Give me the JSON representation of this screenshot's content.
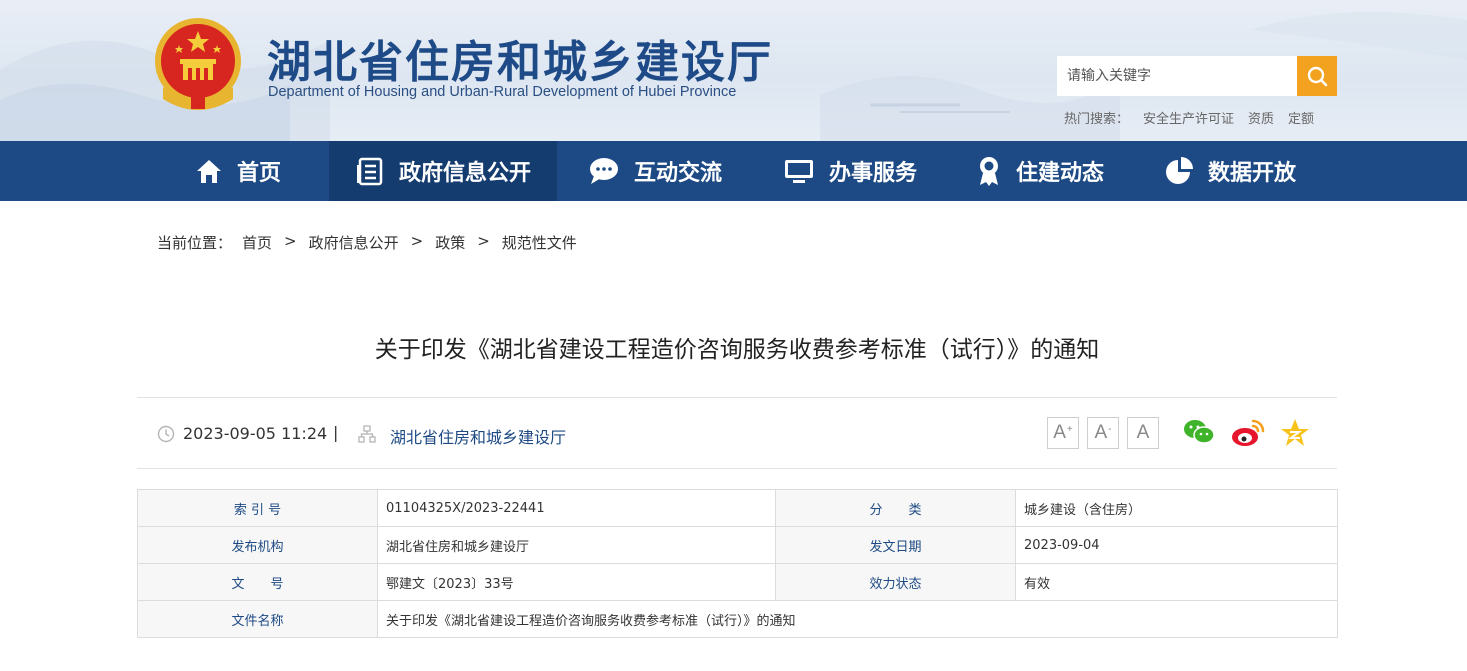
{
  "header": {
    "title": "湖北省住房和城乡建设厅",
    "subtitle": "Department of Housing and Urban-Rural Development of Hubei Province",
    "search": {
      "placeholder": "请输入关键字"
    },
    "hot_search": {
      "label": "热门搜索：",
      "links": [
        "安全生产许可证",
        "资质",
        "定额"
      ]
    }
  },
  "nav": {
    "items": [
      {
        "label": "首页",
        "icon": "home-icon"
      },
      {
        "label": "政府信息公开",
        "icon": "document-list-icon",
        "active": true
      },
      {
        "label": "互动交流",
        "icon": "chat-bubble-icon"
      },
      {
        "label": "办事服务",
        "icon": "monitor-icon"
      },
      {
        "label": "住建动态",
        "icon": "award-icon"
      },
      {
        "label": "数据开放",
        "icon": "pie-chart-icon"
      }
    ]
  },
  "breadcrumb": {
    "prefix": "当前位置：",
    "items": [
      "首页",
      "政府信息公开",
      "政策",
      "规范性文件"
    ],
    "separator": ">"
  },
  "article": {
    "title": "关于印发《湖北省建设工程造价咨询服务收费参考标准（试行）》的通知",
    "datetime": "2023-09-05 11:24",
    "divider": "|",
    "source": "湖北省住房和城乡建设厅",
    "font_buttons": [
      "A",
      "A",
      "A"
    ],
    "share_icons": [
      "wechat-icon",
      "weibo-icon",
      "qzone-icon"
    ]
  },
  "info_table": {
    "rows": [
      {
        "label1": "索 引 号",
        "value1": "01104325X/2023-22441",
        "label2": "分　　类",
        "value2": "城乡建设（含住房）"
      },
      {
        "label1": "发布机构",
        "value1": "湖北省住房和城乡建设厅",
        "label2": "发文日期",
        "value2": "2023-09-04"
      },
      {
        "label1": "文　　号",
        "value1": "鄂建文〔2023〕33号",
        "label2": "效力状态",
        "value2": "有效"
      },
      {
        "label1": "文件名称",
        "value1": "关于印发《湖北省建设工程造价咨询服务收费参考标准（试行）》的通知"
      }
    ]
  },
  "colors": {
    "nav_bg": "#1d4a84",
    "nav_active": "#153c6f",
    "accent": "#f3a21f",
    "title_blue": "#1e4b87"
  }
}
